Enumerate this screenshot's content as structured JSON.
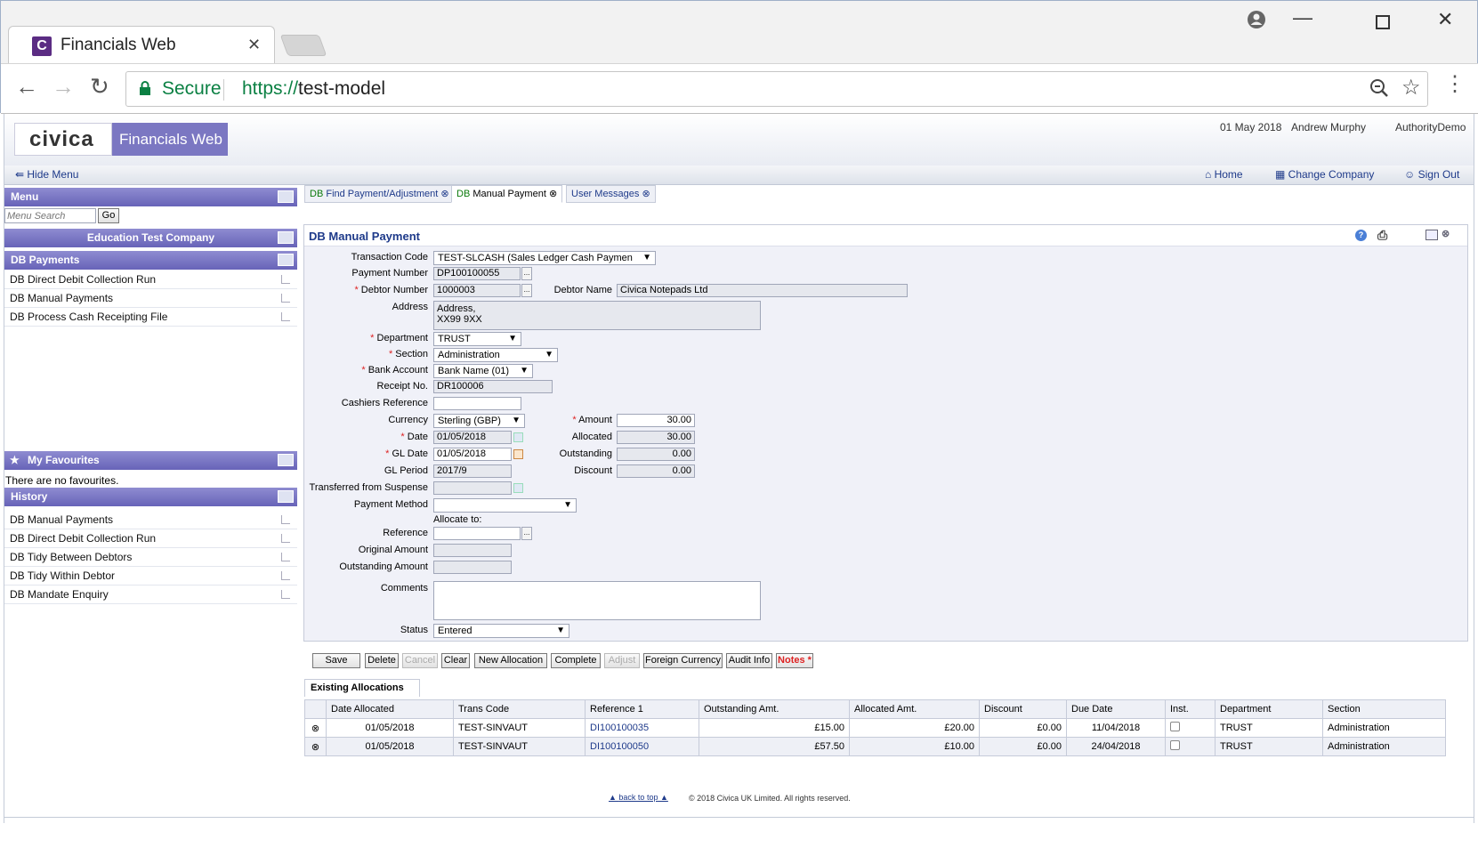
{
  "browser": {
    "tab_title": "Financials Web",
    "secure_label": "Secure",
    "url_scheme": "https://",
    "url_host": "test-model"
  },
  "header": {
    "logo_text": "civica",
    "product_name": "Financials Web",
    "date": "01 May 2018",
    "user": "Andrew Murphy",
    "authority": "AuthorityDemo",
    "hide_menu": "Hide Menu",
    "home": "Home",
    "change_company": "Change Company",
    "sign_out": "Sign Out"
  },
  "sidebar": {
    "menu_title": "Menu",
    "menu_search_placeholder": "Menu Search",
    "go_label": "Go",
    "company": "Education Test Company",
    "section_title": "DB Payments",
    "items": [
      {
        "label": "DB Direct Debit Collection Run"
      },
      {
        "label": "DB Manual Payments"
      },
      {
        "label": "DB Process Cash Receipting File"
      }
    ],
    "favourites_title": "My Favourites",
    "favourites_empty": "There are no favourites.",
    "history_title": "History",
    "history": [
      {
        "label": "DB Manual Payments"
      },
      {
        "label": "DB Direct Debit Collection Run"
      },
      {
        "label": "DB Tidy Between Debtors"
      },
      {
        "label": "DB Tidy Within Debtor"
      },
      {
        "label": "DB Mandate Enquiry"
      }
    ]
  },
  "tabs": [
    {
      "prefix": "DB",
      "label": "Find Payment/Adjustment"
    },
    {
      "prefix": "DB",
      "label": "Manual Payment"
    },
    {
      "prefix": "",
      "label": "User Messages"
    }
  ],
  "form": {
    "title": "DB Manual Payment",
    "labels": {
      "transaction_code": "Transaction Code",
      "payment_number": "Payment Number",
      "debtor_number": "Debtor Number",
      "debtor_name": "Debtor Name",
      "address": "Address",
      "department": "Department",
      "section": "Section",
      "bank_account": "Bank Account",
      "receipt_no": "Receipt No.",
      "cashiers_reference": "Cashiers Reference",
      "currency": "Currency",
      "amount": "Amount",
      "date": "Date",
      "allocated": "Allocated",
      "gl_date": "GL Date",
      "outstanding": "Outstanding",
      "gl_period": "GL Period",
      "discount": "Discount",
      "transferred_from_suspense": "Transferred from Suspense",
      "payment_method": "Payment Method",
      "allocate_to": "Allocate to:",
      "reference": "Reference",
      "original_amount": "Original Amount",
      "outstanding_amount": "Outstanding Amount",
      "comments": "Comments",
      "status": "Status"
    },
    "values": {
      "transaction_code": "TEST-SLCASH (Sales Ledger Cash Paymen",
      "payment_number": "DP100100055",
      "debtor_number": "1000003",
      "debtor_name": "Civica Notepads Ltd",
      "address_line1": "Address,",
      "address_line2": "XX99 9XX",
      "department": "TRUST",
      "section": "Administration",
      "bank_account": "Bank Name (01)",
      "receipt_no": "DR100006",
      "cashiers_reference": "",
      "currency": "Sterling (GBP)",
      "amount": "30.00",
      "date": "01/05/2018",
      "allocated": "30.00",
      "gl_date": "01/05/2018",
      "outstanding": "0.00",
      "gl_period": "2017/9",
      "discount": "0.00",
      "status": "Entered"
    }
  },
  "buttons": [
    {
      "label": "Save",
      "enabled": true
    },
    {
      "label": "Delete",
      "enabled": true
    },
    {
      "label": "Cancel",
      "enabled": false
    },
    {
      "label": "Clear",
      "enabled": true
    },
    {
      "label": "New Allocation",
      "enabled": true
    },
    {
      "label": "Complete",
      "enabled": true
    },
    {
      "label": "Adjust",
      "enabled": false
    },
    {
      "label": "Foreign Currency",
      "enabled": true
    },
    {
      "label": "Audit Info",
      "enabled": true
    },
    {
      "label": "Notes",
      "enabled": true
    }
  ],
  "allocations": {
    "tab_label": "Existing Allocations",
    "columns": [
      "Date Allocated",
      "Trans Code",
      "Reference 1",
      "Outstanding Amt.",
      "Allocated Amt.",
      "Discount",
      "Due Date",
      "Inst.",
      "Department",
      "Section"
    ],
    "rows": [
      {
        "date": "01/05/2018",
        "trans_code": "TEST-SINVAUT",
        "reference": "DI100100035",
        "outstanding": "£15.00",
        "allocated": "£20.00",
        "discount": "£0.00",
        "due_date": "11/04/2018",
        "department": "TRUST",
        "section": "Administration"
      },
      {
        "date": "01/05/2018",
        "trans_code": "TEST-SINVAUT",
        "reference": "DI100100050",
        "outstanding": "£57.50",
        "allocated": "£10.00",
        "discount": "£0.00",
        "due_date": "24/04/2018",
        "department": "TRUST",
        "section": "Administration"
      }
    ]
  },
  "footer": {
    "back_to_top": "back to top",
    "copyright": "© 2018 Civica UK Limited. All rights reserved."
  }
}
